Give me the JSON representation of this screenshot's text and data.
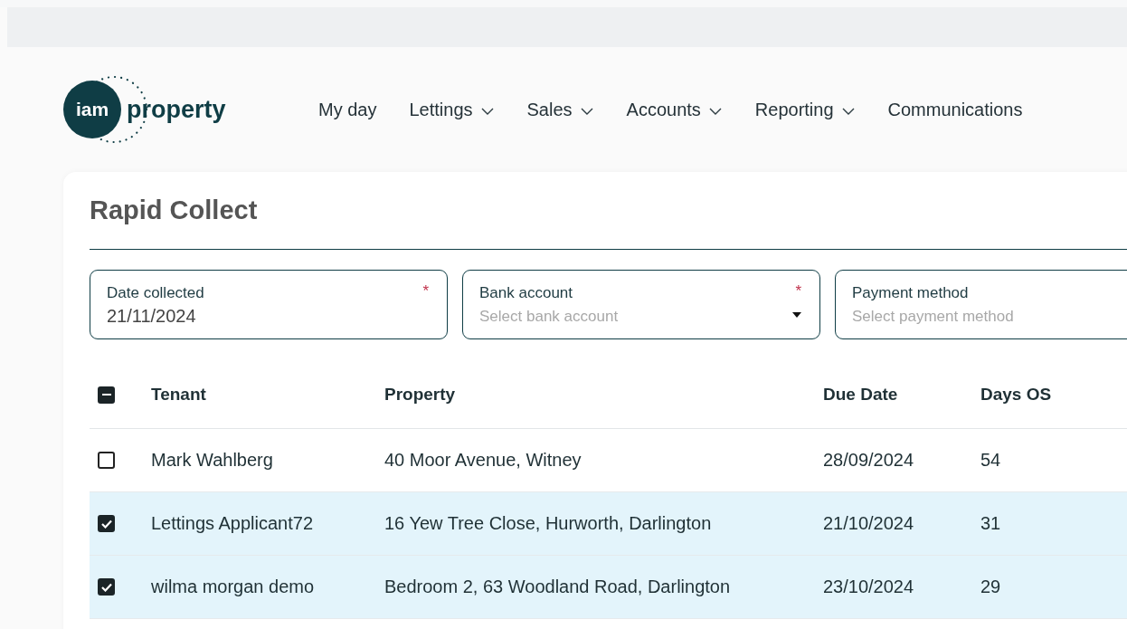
{
  "logo": {
    "circle_text": "iam",
    "text": "property"
  },
  "nav": [
    {
      "label": "My day",
      "dropdown": false
    },
    {
      "label": "Lettings",
      "dropdown": true
    },
    {
      "label": "Sales",
      "dropdown": true
    },
    {
      "label": "Accounts",
      "dropdown": true
    },
    {
      "label": "Reporting",
      "dropdown": true
    },
    {
      "label": "Communications",
      "dropdown": false
    }
  ],
  "title": "Rapid Collect",
  "fields": [
    {
      "label": "Date collected",
      "required_mark": "*",
      "value": "21/11/2024",
      "kind": "text"
    },
    {
      "label": "Bank account",
      "required_mark": "*",
      "placeholder": "Select bank account",
      "kind": "select"
    },
    {
      "label": "Payment method",
      "placeholder": "Select payment method",
      "kind": "select-cut"
    }
  ],
  "table": {
    "select_all_partial": true,
    "columns": [
      "Tenant",
      "Property",
      "Due Date",
      "Days OS"
    ],
    "rows": [
      {
        "selected": false,
        "cells": [
          "Mark Wahlberg",
          "40 Moor Avenue, Witney",
          "28/09/2024",
          "54"
        ]
      },
      {
        "selected": true,
        "cells": [
          "Lettings Applicant72",
          "16 Yew Tree Close, Hurworth, Darlington",
          "21/10/2024",
          "31"
        ]
      },
      {
        "selected": true,
        "cells": [
          "wilma morgan demo",
          "Bedroom 2, 63 Woodland Road, Darlington",
          "23/10/2024",
          "29"
        ]
      }
    ]
  }
}
